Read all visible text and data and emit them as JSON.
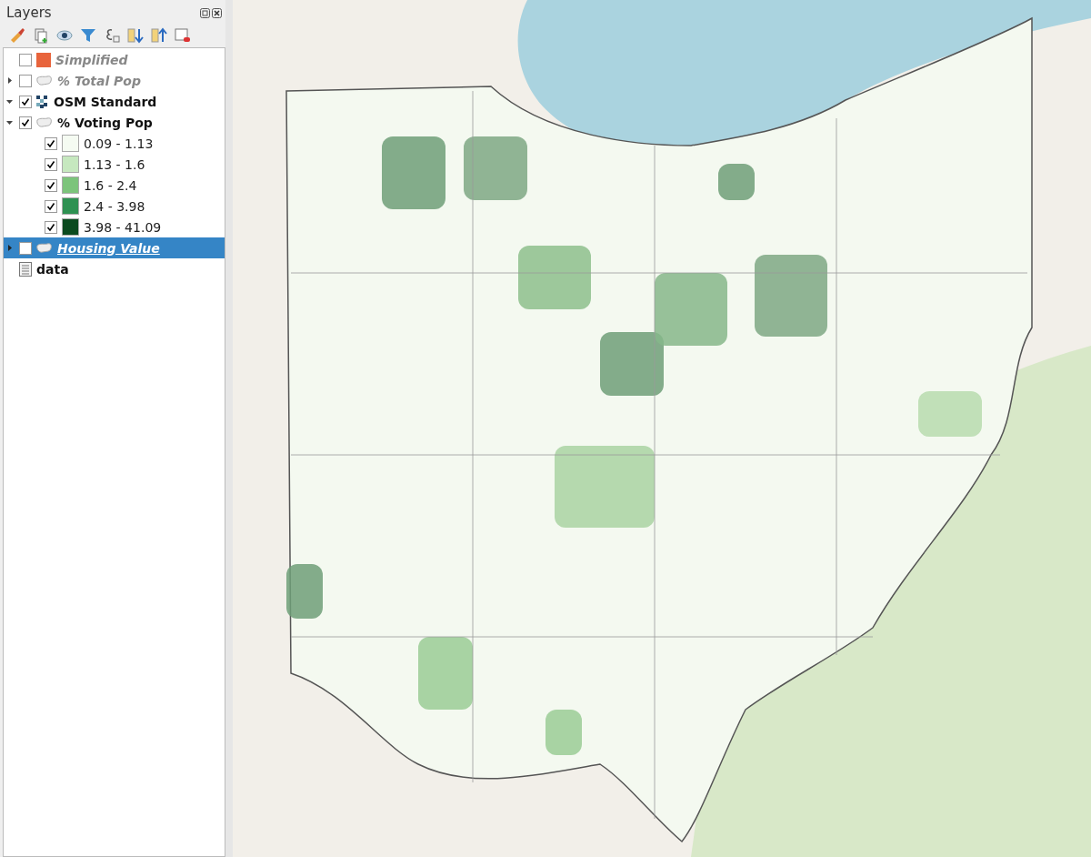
{
  "panel": {
    "title": "Layers"
  },
  "layers": [
    {
      "name": "Simplified",
      "kind": "fill",
      "color": "#e8643c",
      "checked": false,
      "selected": false
    },
    {
      "name": "% Total Pop",
      "kind": "polygon",
      "checked": false,
      "expanded": false,
      "selected": false
    },
    {
      "name": "OSM Standard",
      "kind": "raster",
      "checked": true,
      "expanded": true,
      "selected": false
    },
    {
      "name": "% Voting Pop",
      "kind": "polygon",
      "checked": true,
      "expanded": true,
      "selected": false,
      "children": [
        {
          "label": "0.09 - 1.13",
          "color": "#f5fbf2",
          "checked": true
        },
        {
          "label": "1.13 - 1.6",
          "color": "#c6e8bf",
          "checked": true
        },
        {
          "label": "1.6 - 2.4",
          "color": "#7cc47b",
          "checked": true
        },
        {
          "label": "2.4 - 3.98",
          "color": "#2e9152",
          "checked": true
        },
        {
          "label": "3.98 - 41.09",
          "color": "#0b4a1f",
          "checked": true
        }
      ]
    },
    {
      "name": "Housing Value",
      "kind": "polygon",
      "checked": false,
      "expanded": false,
      "selected": true
    },
    {
      "name": "data",
      "kind": "table",
      "selected": false
    }
  ]
}
